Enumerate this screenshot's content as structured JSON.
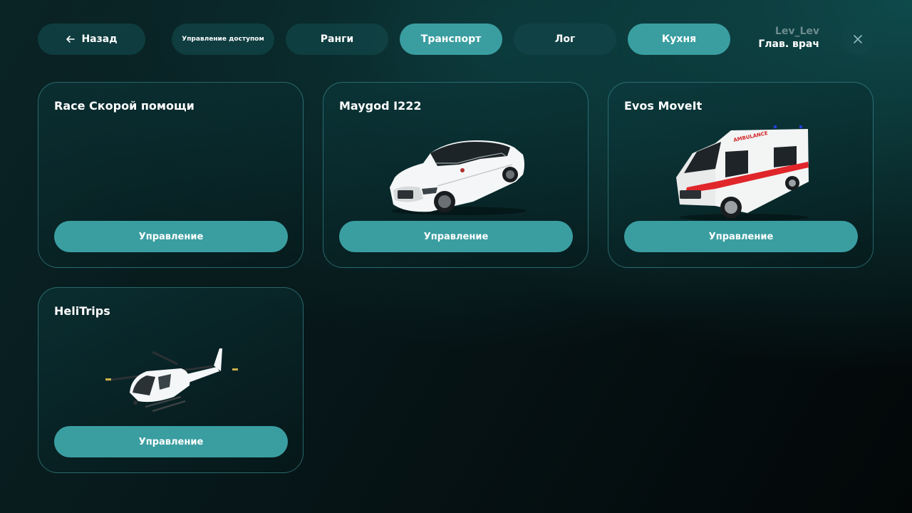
{
  "header": {
    "back_label": "Назад",
    "tabs": [
      {
        "label": "Управление доступом",
        "active": false
      },
      {
        "label": "Ранги",
        "active": false
      },
      {
        "label": "Транспорт",
        "active": true
      },
      {
        "label": "Лог",
        "active": false
      },
      {
        "label": "Кухня",
        "active": true
      }
    ],
    "user": {
      "name": "Lev_Lev",
      "role": "Глав. врач"
    },
    "icons": {
      "back": "arrow-left-icon",
      "close": "close-icon"
    }
  },
  "vehicles": [
    {
      "title": "Race Скорой помощи",
      "image": "none",
      "button": "Управление"
    },
    {
      "title": "Maygod I222",
      "image": "white-sedan",
      "button": "Управление"
    },
    {
      "title": "Evos MoveIt",
      "image": "ambulance-van",
      "button": "Управление"
    },
    {
      "title": "HeliTrips",
      "image": "white-helicopter",
      "button": "Управление"
    }
  ],
  "colors": {
    "accent": "#3a9ea1",
    "pill_inactive": "#124648",
    "card_border": "#46a0a5",
    "muted_text": "#6c8c8e"
  }
}
